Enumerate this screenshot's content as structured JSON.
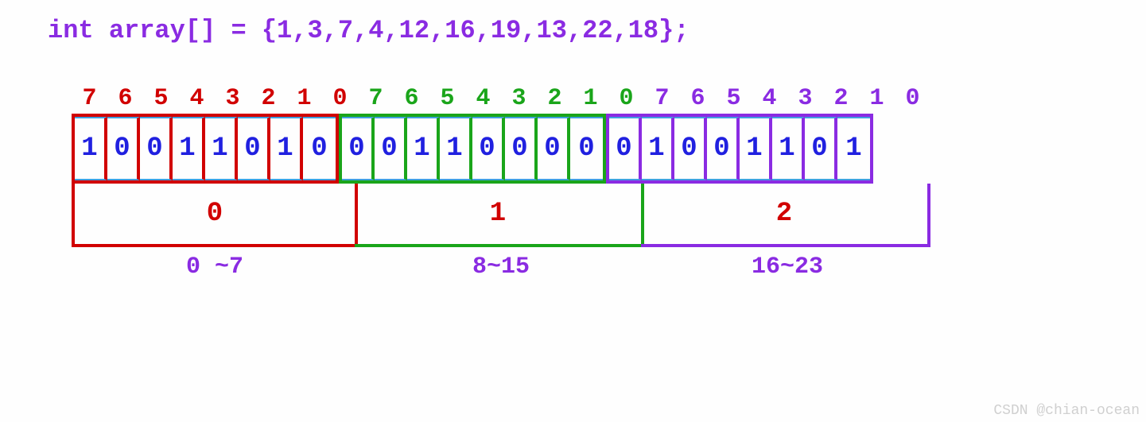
{
  "title": "int array[] = {1,3,7,4,12,16,19,13,22,18};",
  "groups": [
    {
      "color": "red",
      "headers": [
        "7",
        "6",
        "5",
        "4",
        "3",
        "2",
        "1",
        "0"
      ],
      "bits": [
        "1",
        "0",
        "0",
        "1",
        "1",
        "0",
        "1",
        "0"
      ],
      "bucket_label": "0",
      "range": "0 ~7"
    },
    {
      "color": "green",
      "headers": [
        "7",
        "6",
        "5",
        "4",
        "3",
        "2",
        "1",
        "0"
      ],
      "bits": [
        "0",
        "0",
        "1",
        "1",
        "0",
        "0",
        "0",
        "0"
      ],
      "bucket_label": "1",
      "range": "8~15"
    },
    {
      "color": "purple",
      "headers": [
        "7",
        "6",
        "5",
        "4",
        "3",
        "2",
        "1",
        "0"
      ],
      "bits": [
        "0",
        "1",
        "0",
        "0",
        "1",
        "1",
        "0",
        "1"
      ],
      "bucket_label": "2",
      "range": "16~23"
    }
  ],
  "watermark": "CSDN @chian-ocean"
}
